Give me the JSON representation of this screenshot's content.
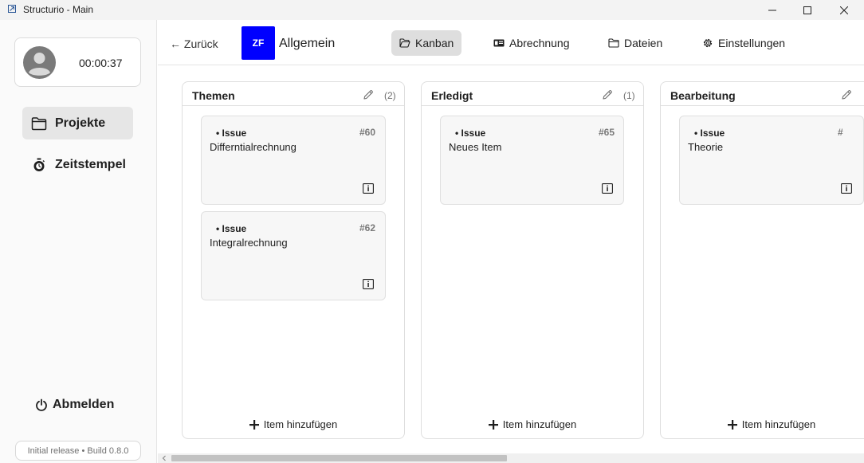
{
  "window": {
    "title": "Structurio - Main"
  },
  "user": {
    "timer": "00:00:37"
  },
  "sidebar": {
    "items": [
      {
        "label": "Projekte",
        "icon": "folder-icon",
        "active": true
      },
      {
        "label": "Zeitstempel",
        "icon": "stopwatch-icon",
        "active": false
      }
    ],
    "logout_label": "Abmelden",
    "version": "Initial release • Build 0.8.0"
  },
  "header": {
    "back_label": "← Zurück",
    "project_badge": "ZF",
    "project_name": "Allgemein",
    "accent_color": "#0000ff",
    "tabs": [
      {
        "label": "Kanban",
        "icon": "folder-open-icon",
        "active": true
      },
      {
        "label": "Abrechnung",
        "icon": "billing-icon",
        "active": false
      },
      {
        "label": "Dateien",
        "icon": "folder-icon",
        "active": false
      },
      {
        "label": "Einstellungen",
        "icon": "gear-icon",
        "active": false
      }
    ]
  },
  "board": {
    "add_item_label": "Item hinzufügen",
    "columns": [
      {
        "title": "Themen",
        "count": "(2)",
        "cards": [
          {
            "type": "Issue",
            "number": "#60",
            "title": "Differntialrechnung"
          },
          {
            "type": "Issue",
            "number": "#62",
            "title": "Integralrechnung"
          }
        ]
      },
      {
        "title": "Erledigt",
        "count": "(1)",
        "cards": [
          {
            "type": "Issue",
            "number": "#65",
            "title": "Neues Item"
          }
        ]
      },
      {
        "title": "Bearbeitung",
        "count": "",
        "cards": [
          {
            "type": "Issue",
            "number": "#",
            "title": "Theorie"
          }
        ]
      }
    ]
  }
}
